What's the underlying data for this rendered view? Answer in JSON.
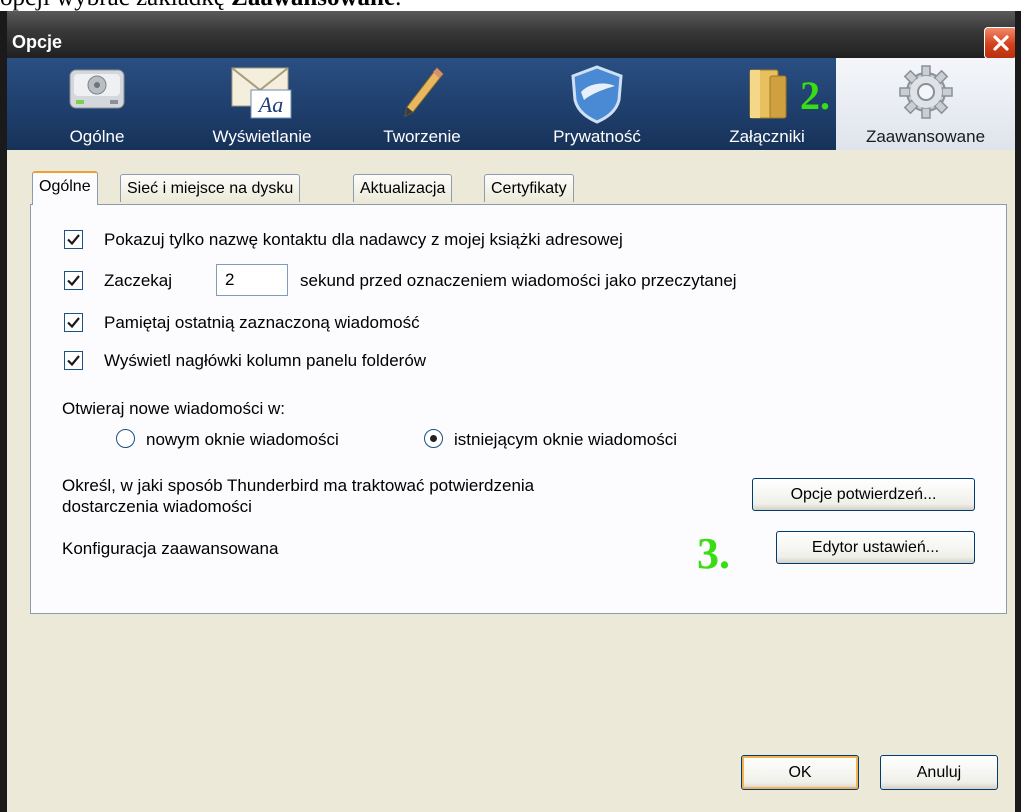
{
  "document": {
    "before_bold": "opcji wybrać zakładkę ",
    "bold": "Zaawansowane",
    "after_bold": "."
  },
  "window": {
    "title": "Opcje"
  },
  "toolbar": {
    "panes": [
      {
        "label": "Ogólne",
        "icon": "hard-drive-icon"
      },
      {
        "label": "Wyświetlanie",
        "icon": "envelope-font-icon"
      },
      {
        "label": "Tworzenie",
        "icon": "pencil-icon"
      },
      {
        "label": "Prywatność",
        "icon": "shield-icon"
      },
      {
        "label": "Załączniki",
        "icon": "folder-icon"
      },
      {
        "label": "Zaawansowane",
        "icon": "gear-icon",
        "selected": true
      }
    ]
  },
  "annotations": {
    "step2": "2.",
    "step3": "3."
  },
  "tabs": [
    {
      "label": "Ogólne",
      "active": true
    },
    {
      "label": "Sieć i miejsce na dysku"
    },
    {
      "label": "Aktualizacja"
    },
    {
      "label": "Certyfikaty"
    }
  ],
  "general": {
    "show_name_only": {
      "label": "Pokazuj tylko nazwę kontaktu dla nadawcy z mojej książki adresowej",
      "checked": true
    },
    "wait": {
      "label": "Zaczekaj",
      "value": "2",
      "suffix": "sekund przed oznaczeniem wiadomości jako przeczytanej",
      "checked": true
    },
    "remember_last": {
      "label": "Pamiętaj ostatnią zaznaczoną wiadomość",
      "checked": true
    },
    "show_headers": {
      "label": "Wyświetl nagłówki kolumn panelu folderów",
      "checked": true
    },
    "open_new_label": "Otwieraj nowe wiadomości w:",
    "radio_new_window": "nowym oknie wiadomości",
    "radio_existing_window": "istniejącym oknie wiadomości",
    "selected_radio": "existing",
    "receipts_text_1": "Określ, w jaki sposób Thunderbird ma traktować potwierdzenia",
    "receipts_text_2": "dostarczenia wiadomości",
    "receipts_button": "Opcje potwierdzeń...",
    "config_label": "Konfiguracja zaawansowana",
    "config_button": "Edytor ustawień..."
  },
  "footer": {
    "ok": "OK",
    "cancel": "Anuluj"
  },
  "colors": {
    "annotation": "#3adc14",
    "toolbar": "#1f3f6d",
    "close": "#d4401c"
  }
}
